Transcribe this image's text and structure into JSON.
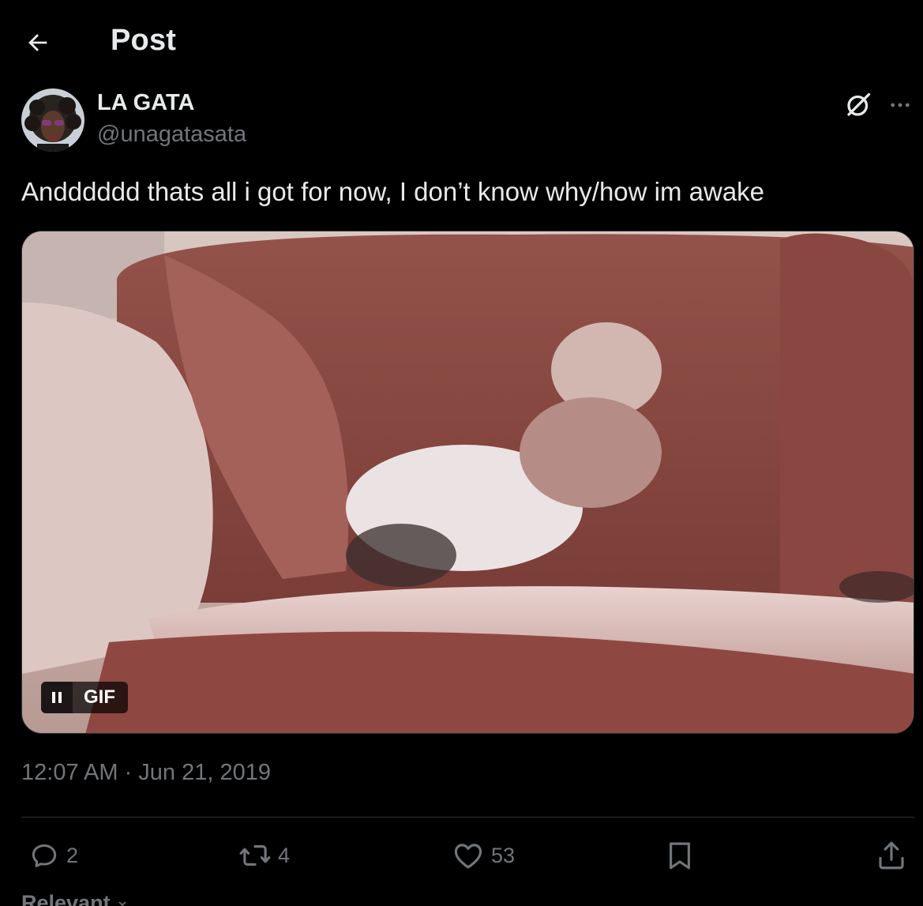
{
  "header": {
    "title": "Post",
    "back_icon": "arrow-left-icon"
  },
  "author": {
    "display_name": "LA GATA",
    "handle": "@unagatasata"
  },
  "tweet": {
    "text": "Andddddd thats all i got for now, I don’t know why/how im awake",
    "media_badge": "GIF",
    "timestamp": "12:07 AM · Jun 21, 2019"
  },
  "actions": {
    "replies": "2",
    "reposts": "4",
    "likes": "53"
  },
  "footer": {
    "sort_label": "Relevant"
  },
  "colors": {
    "background": "#000000",
    "text_primary": "#e7e9ea",
    "text_secondary": "#71767b",
    "divider": "#2f3336"
  }
}
